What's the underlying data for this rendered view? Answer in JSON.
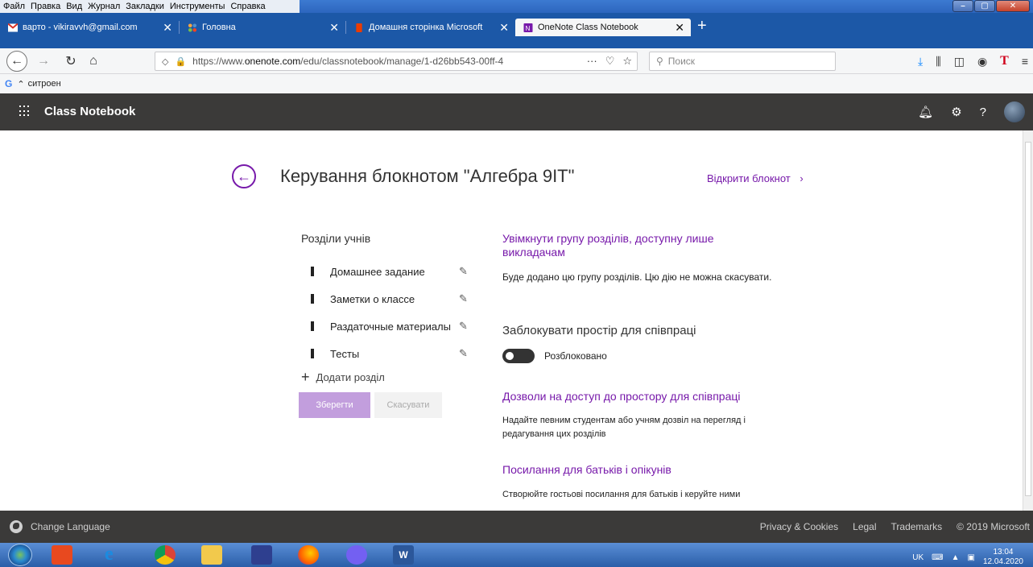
{
  "menubar": {
    "items": [
      "Файл",
      "Правка",
      "Вид",
      "Журнал",
      "Закладки",
      "Инструменты",
      "Справка"
    ]
  },
  "tabs": [
    {
      "title": "варто - vikiravvh@gmail.com",
      "icon": "gmail-icon",
      "active": false
    },
    {
      "title": "Головна",
      "icon": "joomla-icon",
      "active": false
    },
    {
      "title": "Домашня сторінка Microsoft",
      "icon": "office-icon",
      "active": false
    },
    {
      "title": "OneNote Class Notebook",
      "icon": "onenote-icon",
      "active": true
    }
  ],
  "navbar": {
    "url_prefix": "https://www.",
    "url_domain": "onenote.com",
    "url_rest": "/edu/classnotebook/manage/1-d26bb543-00ff-4",
    "search_placeholder": "Поиск",
    "url_actions_more": "···"
  },
  "bookmarks": {
    "g_label": "G",
    "item": "ситроен"
  },
  "appbar": {
    "title": "Class Notebook"
  },
  "main": {
    "page_title": "Керування блокнотом \"Алгебра 9IT\"",
    "open_link": "Відкрити блокнот",
    "sections_heading": "Розділи учнів",
    "sections": [
      "Домашнее задание",
      "Заметки о классе",
      "Раздаточные материалы",
      "Тесты"
    ],
    "add_section": "Додати розділ",
    "save_label": "Зберегти",
    "cancel_label": "Скасувати",
    "teacher_group_link": "Увімкнути групу розділів, доступну лише викладачам",
    "teacher_group_text": "Буде додано цю групу розділів. Цю дію не можна скасувати.",
    "lock_heading": "Заблокувати простір для співпраці",
    "lock_state": "Розблоковано",
    "permissions_link": "Дозволи на доступ до простору для співпраці",
    "permissions_text": "Надайте певним студентам або учням дозвіл на перегляд і редагування цих розділів",
    "parents_link": "Посилання для батьків і опікунів",
    "parents_text": "Створюйте гостьові посилання для батьків і керуйте ними"
  },
  "footer": {
    "change_language": "Change Language",
    "links": [
      "Privacy & Cookies",
      "Legal",
      "Trademarks",
      "© 2019 Microsoft"
    ]
  },
  "taskbar": {
    "lang": "UK",
    "time": "13:04",
    "date": "12.04.2020"
  },
  "colors": {
    "accent": "#7719aa",
    "appbar": "#3b3a39",
    "save_button": "#c29edd"
  }
}
